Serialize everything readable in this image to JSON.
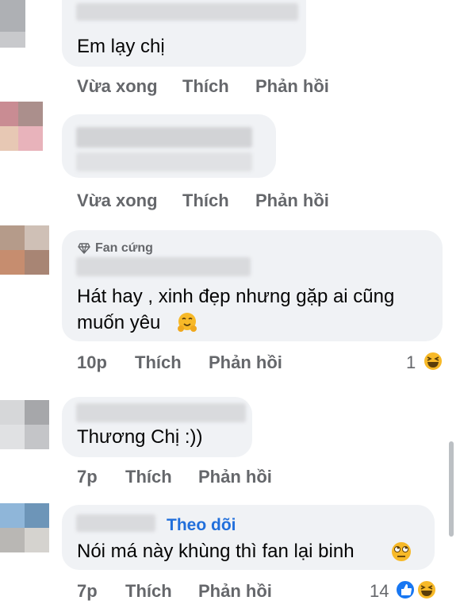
{
  "comments": [
    {
      "text": "Em lạy chị",
      "meta": {
        "time": "Vừa xong",
        "like": "Thích",
        "reply": "Phản hồi"
      }
    },
    {
      "text": "",
      "meta": {
        "time": "Vừa xong",
        "like": "Thích",
        "reply": "Phản hồi"
      }
    },
    {
      "badge": "Fan cứng",
      "text_line1": "Hát hay , xinh đẹp nhưng gặp ai cũng",
      "text_line2": "muốn yêu",
      "meta": {
        "time": "10p",
        "like": "Thích",
        "reply": "Phản hồi"
      },
      "reaction_count": "1"
    },
    {
      "text": "Thương Chị :))",
      "meta": {
        "time": "7p",
        "like": "Thích",
        "reply": "Phản hồi"
      }
    },
    {
      "follow": "Theo dõi",
      "text": "Nói má này khùng thì fan lại binh",
      "meta": {
        "time": "7p",
        "like": "Thích",
        "reply": "Phản hồi"
      },
      "reaction_count": "14"
    }
  ],
  "icons": {
    "badge": "diamond-icon",
    "reactions": [
      "haha-icon",
      "like-icon",
      "hug-icon",
      "eye-roll-icon"
    ]
  },
  "colors": {
    "bubble": "#f0f2f5",
    "meta": "#65676b",
    "link": "#216fdb",
    "like": "#1877f2",
    "haha": "#f7b928"
  }
}
